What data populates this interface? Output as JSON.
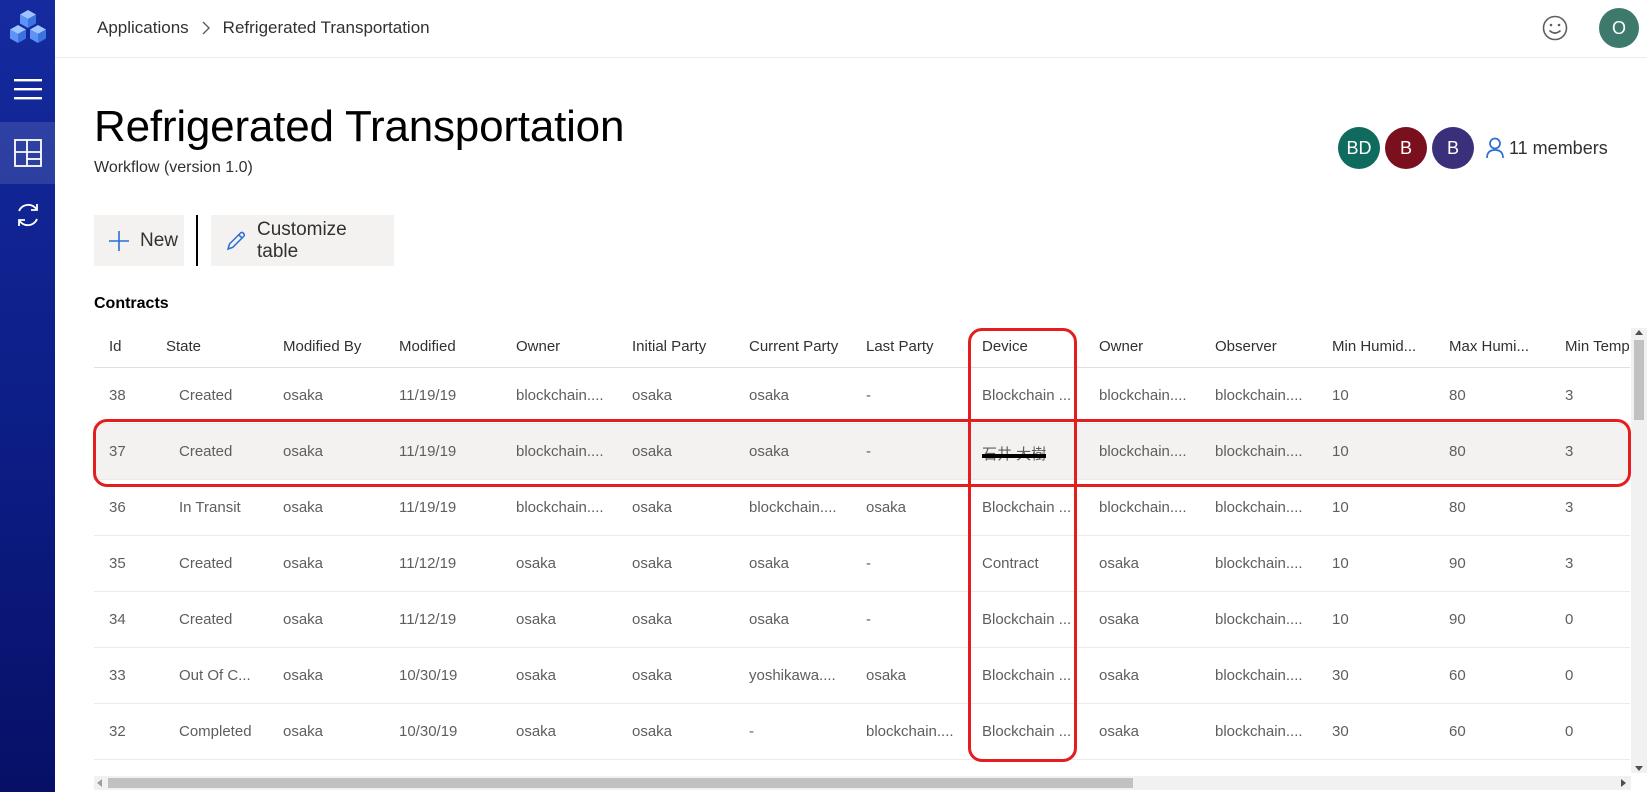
{
  "breadcrumb": {
    "root": "Applications",
    "current": "Refrigerated Transportation"
  },
  "user": {
    "initial": "O",
    "color": "#3d7a6d"
  },
  "header": {
    "title": "Refrigerated Transportation",
    "subtitle": "Workflow (version 1.0)"
  },
  "members": {
    "avatars": [
      {
        "initials": "BD",
        "color": "#0e6b5e"
      },
      {
        "initials": "B",
        "color": "#7a0f1e"
      },
      {
        "initials": "B",
        "color": "#3a2f7a"
      }
    ],
    "count_label": "11 members"
  },
  "toolbar": {
    "new_label": "New",
    "customize_label": "Customize table"
  },
  "section": {
    "contracts_label": "Contracts"
  },
  "table": {
    "columns": [
      "Id",
      "State",
      "Modified By",
      "Modified",
      "Owner",
      "Initial Party",
      "Current Party",
      "Last Party",
      "Device",
      "Owner",
      "Observer",
      "Min Humid...",
      "Max Humi...",
      "Min Temp"
    ],
    "rows": [
      [
        "38",
        "Created",
        "osaka",
        "11/19/19",
        "blockchain....",
        "osaka",
        "osaka",
        "-",
        "Blockchain ...",
        "blockchain....",
        "blockchain....",
        "10",
        "80",
        "3"
      ],
      [
        "37",
        "Created",
        "osaka",
        "11/19/19",
        "blockchain....",
        "osaka",
        "osaka",
        "-",
        "石井 大樹",
        "blockchain....",
        "blockchain....",
        "10",
        "80",
        "3"
      ],
      [
        "36",
        "In Transit",
        "osaka",
        "11/19/19",
        "blockchain....",
        "osaka",
        "blockchain....",
        "osaka",
        "Blockchain ...",
        "blockchain....",
        "blockchain....",
        "10",
        "80",
        "3"
      ],
      [
        "35",
        "Created",
        "osaka",
        "11/12/19",
        "osaka",
        "osaka",
        "osaka",
        "-",
        "Contract",
        "osaka",
        "blockchain....",
        "10",
        "90",
        "3"
      ],
      [
        "34",
        "Created",
        "osaka",
        "11/12/19",
        "osaka",
        "osaka",
        "osaka",
        "-",
        "Blockchain ...",
        "osaka",
        "blockchain....",
        "10",
        "90",
        "0"
      ],
      [
        "33",
        "Out Of C...",
        "osaka",
        "10/30/19",
        "osaka",
        "osaka",
        "yoshikawa....",
        "osaka",
        "Blockchain ...",
        "osaka",
        "blockchain....",
        "30",
        "60",
        "0"
      ],
      [
        "32",
        "Completed",
        "osaka",
        "10/30/19",
        "osaka",
        "osaka",
        "-",
        "blockchain....",
        "Blockchain ...",
        "osaka",
        "blockchain....",
        "30",
        "60",
        "0"
      ]
    ]
  },
  "colors": {
    "rail": "#0c1d86",
    "highlight": "#e41e1e",
    "selected_row": "#f3f2f1"
  }
}
